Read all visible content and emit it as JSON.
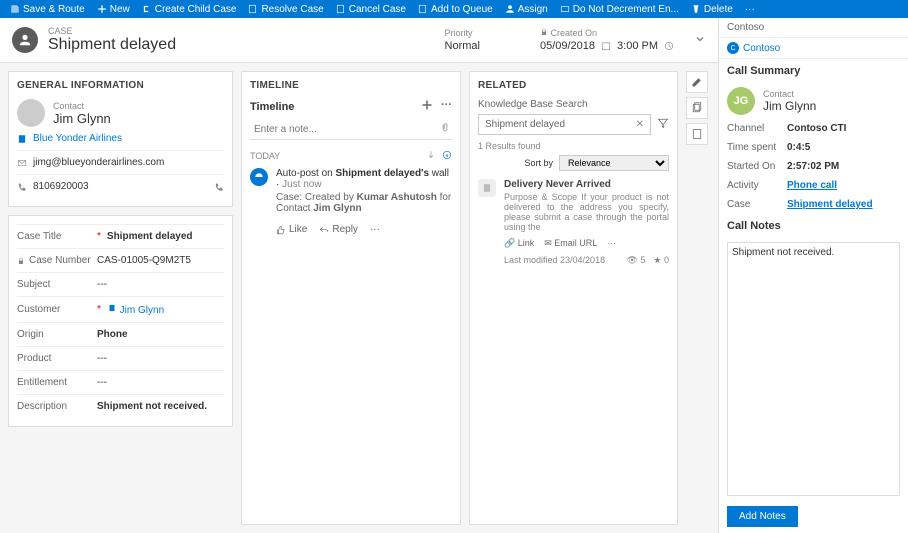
{
  "commands": {
    "save_route": "Save & Route",
    "new": "New",
    "create_child": "Create Child Case",
    "resolve": "Resolve Case",
    "cancel": "Cancel Case",
    "add_queue": "Add to Queue",
    "assign": "Assign",
    "do_not_decrement": "Do Not Decrement En...",
    "delete": "Delete",
    "more": "···"
  },
  "header": {
    "entity": "CASE",
    "title": "Shipment delayed",
    "priority": {
      "label": "Priority",
      "value": "Normal"
    },
    "created": {
      "label": "Created On",
      "date": "05/09/2018",
      "time": "3:00 PM"
    }
  },
  "general": {
    "heading": "GENERAL INFORMATION",
    "contact_label": "Contact",
    "contact_name": "Jim Glynn",
    "company": "Blue Yonder Airlines",
    "email": "jimg@blueyonderairlines.com",
    "phone": "8106920003"
  },
  "caseform": {
    "rows": [
      {
        "label": "Case Title",
        "value": "Shipment delayed",
        "req": true,
        "bold": true
      },
      {
        "label": "Case Number",
        "value": "CAS-01005-Q9M2T5",
        "lock": true
      },
      {
        "label": "Subject",
        "value": "---"
      },
      {
        "label": "Customer",
        "value": "Jim Glynn",
        "req": true,
        "link": true
      },
      {
        "label": "Origin",
        "value": "Phone",
        "bold": true
      },
      {
        "label": "Product",
        "value": "---"
      },
      {
        "label": "Entitlement",
        "value": "---"
      },
      {
        "label": "Description",
        "value": "Shipment not received.",
        "bold": true
      }
    ]
  },
  "timeline": {
    "heading": "TIMELINE",
    "title": "Timeline",
    "note_placeholder": "Enter a note...",
    "today": "TODAY",
    "item": {
      "prefix": "Auto-post on ",
      "subject": "Shipment delayed's",
      "suffix": " wall",
      "time": "Just now",
      "l2a": "Case: Created by ",
      "author": "Kumar Ashutosh",
      "l2b": " for Contact ",
      "who": "Jim Glynn"
    },
    "like": "Like",
    "reply": "Reply"
  },
  "related": {
    "heading": "RELATED",
    "kb_label": "Knowledge Base Search",
    "search_value": "Shipment delayed",
    "results": "1 Results found",
    "sort_label": "Sort by",
    "sort_value": "Relevance",
    "article": {
      "title": "Delivery Never Arrived",
      "desc": "Purpose & Scope If your product is not delivered to the address you specify, please submit a case through the portal using the"
    },
    "link": "Link",
    "email_url": "Email URL",
    "more": "···",
    "modified": "Last modified 23/04/2018",
    "views": "5",
    "rating": "0"
  },
  "side": {
    "tab": "Contoso",
    "org": "Contoso",
    "summary": "Call Summary",
    "contact_label": "Contact",
    "contact_name": "Jim Glynn",
    "initials": "JG",
    "rows": [
      {
        "l": "Channel",
        "v": "Contoso CTI"
      },
      {
        "l": "Time spent",
        "v": "0:4:5"
      },
      {
        "l": "Started On",
        "v": "2:57:02 PM"
      },
      {
        "l": "Activity",
        "v": "Phone call",
        "link": true
      },
      {
        "l": "Case",
        "v": "Shipment delayed",
        "link": true
      }
    ],
    "notes_heading": "Call Notes",
    "notes_value": "Shipment not received.",
    "add": "Add Notes"
  }
}
